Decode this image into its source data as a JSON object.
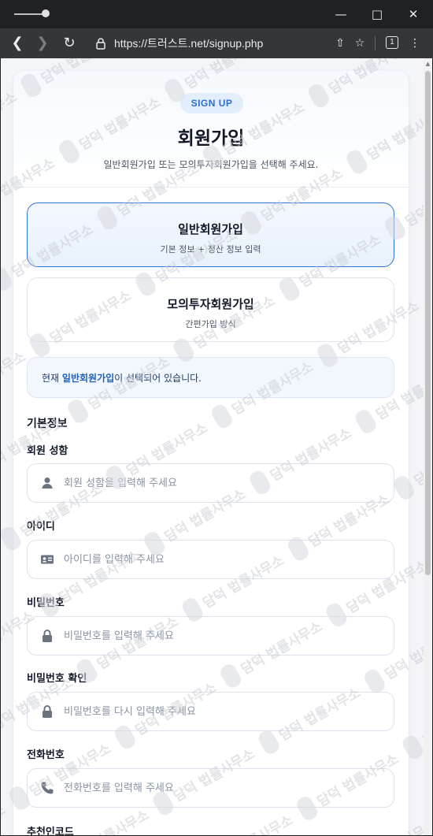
{
  "browser": {
    "url": "https://트러스트.net/signup.php",
    "tab_count": "1"
  },
  "header": {
    "badge": "SIGN UP",
    "title": "회원가입",
    "subtitle": "일반회원가입 또는 모의투자회원가입을 선택해 주세요."
  },
  "signup_types": [
    {
      "title": "일반회원가입",
      "desc": "기본 정보 + 정산 정보 입력",
      "selected": true
    },
    {
      "title": "모의투자회원가입",
      "desc": "간편가입 방식",
      "selected": false
    }
  ],
  "notice": {
    "prefix": "현재 ",
    "selected": "일반회원가입",
    "suffix": "이 선택되어 있습니다."
  },
  "section_title": "기본정보",
  "fields": [
    {
      "label": "회원 성함",
      "placeholder": "회원 성함을 입력해 주세요",
      "icon": "user-icon"
    },
    {
      "label": "아이디",
      "placeholder": "아이디를 입력해 주세요",
      "icon": "id-card-icon"
    },
    {
      "label": "비밀번호",
      "placeholder": "비밀번호를 입력해 주세요",
      "icon": "lock-icon"
    },
    {
      "label": "비밀번호 확인",
      "placeholder": "비밀번호를 다시 입력해 주세요",
      "icon": "lock-icon"
    },
    {
      "label": "전화번호",
      "placeholder": "전화번호를 입력해 주세요",
      "icon": "phone-icon"
    },
    {
      "label": "추천인코드",
      "placeholder": "",
      "icon": ""
    }
  ],
  "watermark": "담덕 법률사무소",
  "colors": {
    "accent": "#2f74d8",
    "badge_bg": "#e3eefc",
    "chrome": "#35363a"
  }
}
